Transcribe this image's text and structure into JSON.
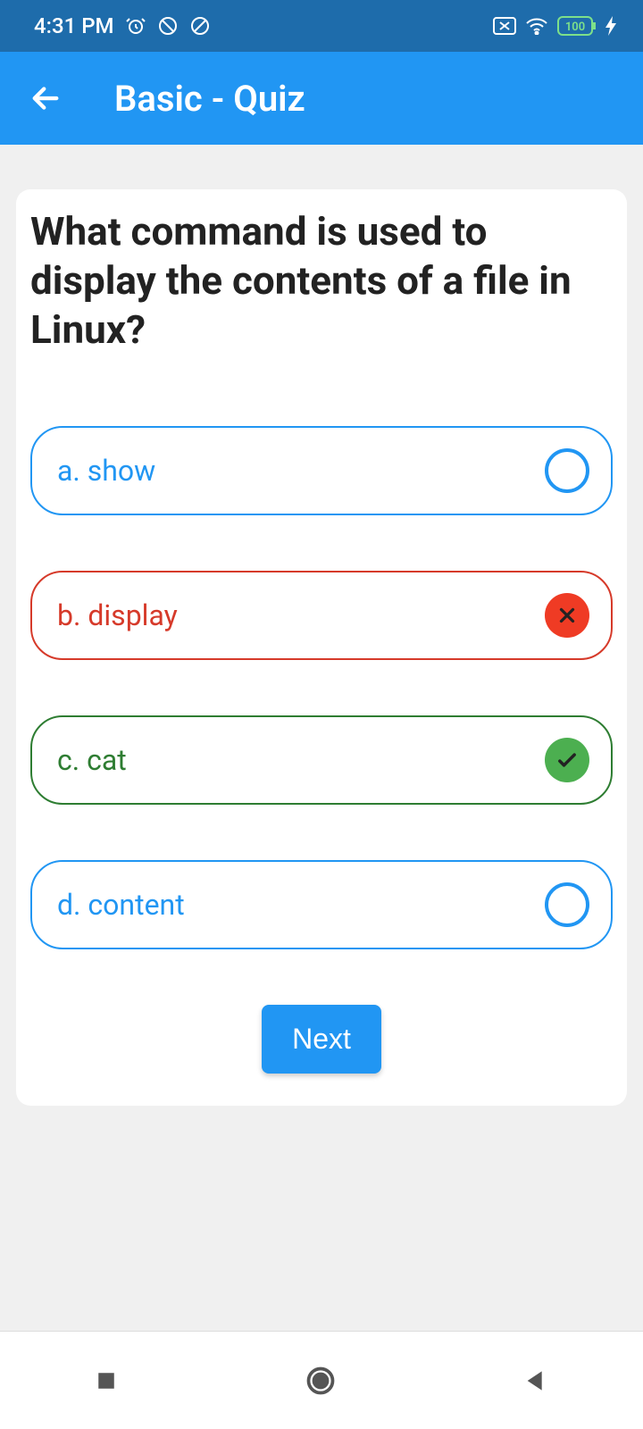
{
  "status": {
    "time": "4:31 PM",
    "battery": "100"
  },
  "header": {
    "title": "Basic - Quiz"
  },
  "question": "What command is used to display the contents of a file in Linux?",
  "options": {
    "a": {
      "label": "a. show",
      "state": "neutral"
    },
    "b": {
      "label": "b. display",
      "state": "wrong"
    },
    "c": {
      "label": "c. cat",
      "state": "correct"
    },
    "d": {
      "label": "d. content",
      "state": "neutral"
    }
  },
  "next_label": "Next"
}
